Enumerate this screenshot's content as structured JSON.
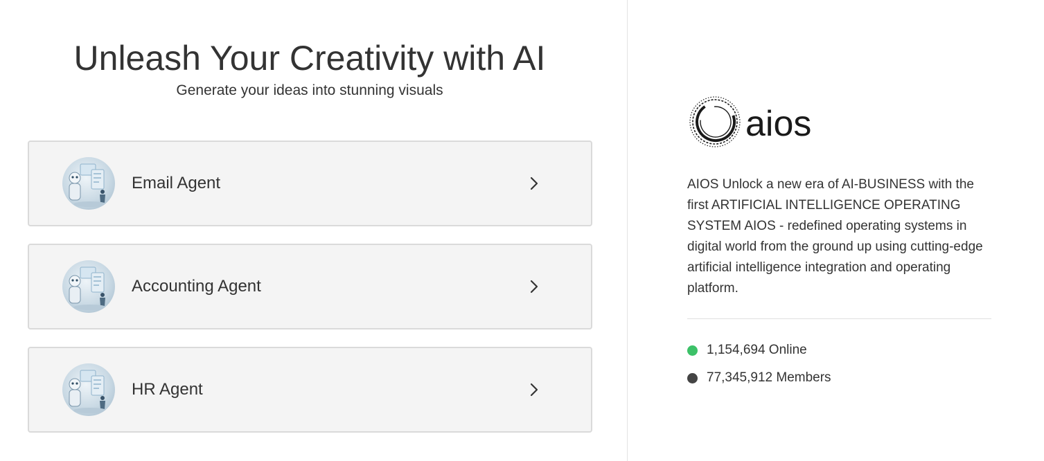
{
  "hero": {
    "title": "Unleash Your Creativity with AI",
    "subtitle": "Generate your ideas into stunning visuals"
  },
  "agents": [
    {
      "label": "Email Agent",
      "icon": "chevron-right-icon"
    },
    {
      "label": "Accounting Agent",
      "icon": "chevron-right-icon"
    },
    {
      "label": "HR Agent",
      "icon": "chevron-right-icon"
    }
  ],
  "brand": {
    "logo_text": "aios"
  },
  "about": {
    "text": "AIOS Unlock a new era of AI-BUSINESS with the first ARTIFICIAL INTELLIGENCE OPERATING SYSTEM AIOS - redefined operating systems in digital world from the ground up using cutting-edge artificial intelligence integration and operating platform."
  },
  "stats": [
    {
      "text": "1,154,694 Online",
      "color": "#3cc168"
    },
    {
      "text": "77,345,912 Members",
      "color": "#444444"
    }
  ]
}
